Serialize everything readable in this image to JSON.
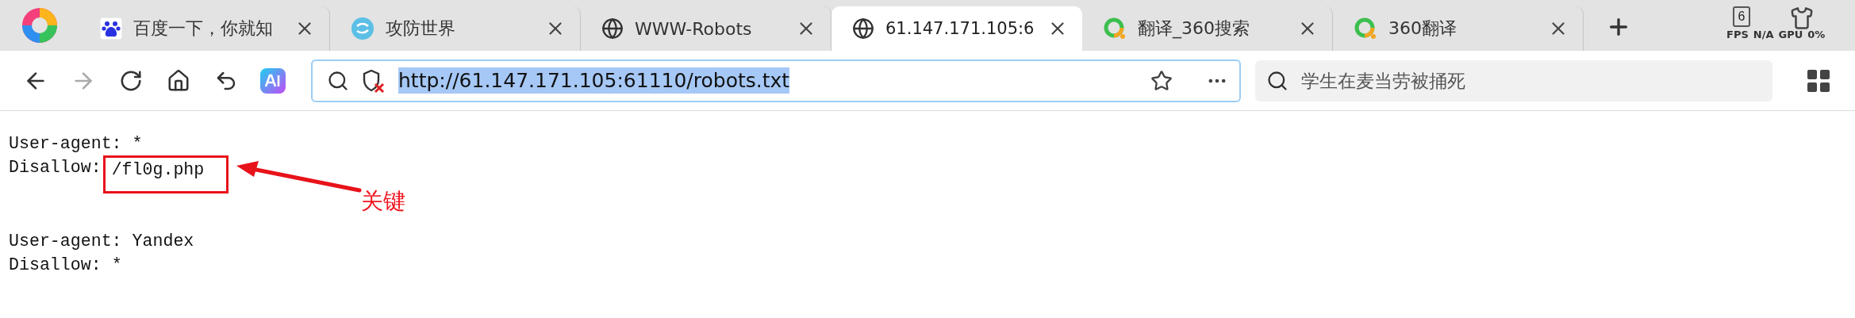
{
  "tabs": [
    {
      "title": "百度一下，你就知",
      "kind": "baidu",
      "selected": false
    },
    {
      "title": "攻防世界",
      "kind": "xctf",
      "selected": false
    },
    {
      "title": "WWW-Robots",
      "kind": "globe",
      "selected": false
    },
    {
      "title": "61.147.171.105:6",
      "kind": "globe",
      "selected": true
    },
    {
      "title": "翻译_360搜索",
      "kind": "ring",
      "selected": false
    },
    {
      "title": "360翻译",
      "kind": "ring",
      "selected": false
    }
  ],
  "tab_count": "6",
  "perf_overlay": [
    "FPS",
    "N/A",
    "GPU",
    "0%"
  ],
  "address_bar": {
    "url": "http://61.147.171.105:61110/robots.txt",
    "url_selected": true
  },
  "search": {
    "placeholder": "学生在麦当劳被捅死"
  },
  "content": {
    "groups": [
      [
        {
          "field": "User-agent:",
          "value": "*",
          "highlighted": false
        },
        {
          "field": "Disallow:",
          "value": "/fl0g.php",
          "highlighted": true
        }
      ],
      [
        {
          "field": "User-agent:",
          "value": "Yandex",
          "highlighted": false
        },
        {
          "field": "Disallow:",
          "value": "*",
          "highlighted": false
        }
      ]
    ]
  },
  "annotation": {
    "label": "关键"
  }
}
